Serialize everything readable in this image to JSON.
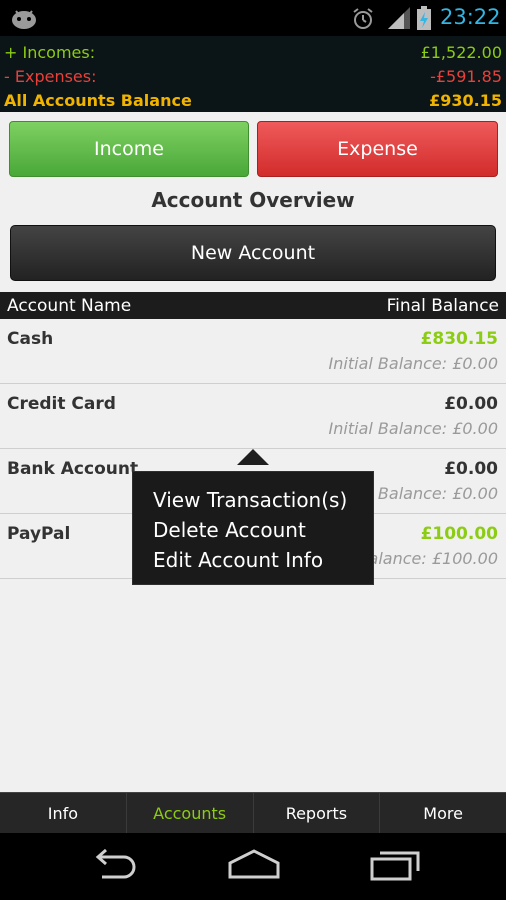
{
  "status_bar": {
    "time": "23:22",
    "icons": [
      "android-icon",
      "alarm-icon",
      "signal-icon",
      "battery-icon"
    ]
  },
  "summary": {
    "incomes_label": "+ Incomes:",
    "incomes_value": "£1,522.00",
    "expenses_label": "- Expenses:",
    "expenses_value": "-£591.85",
    "balance_label": "All Accounts Balance",
    "balance_value": "£930.15"
  },
  "buttons": {
    "income": "Income",
    "expense": "Expense",
    "new_account": "New Account"
  },
  "overview_title": "Account Overview",
  "table_header": {
    "name": "Account Name",
    "balance": "Final Balance"
  },
  "accounts": [
    {
      "name": "Cash",
      "final": "£830.15",
      "initial": "Initial Balance: £0.00",
      "color": "#8ccc14"
    },
    {
      "name": "Credit Card",
      "final": "£0.00",
      "initial": "Initial Balance: £0.00",
      "color": "#333333"
    },
    {
      "name": "Bank Account",
      "final": "£0.00",
      "initial": "Initial Balance: £0.00",
      "color": "#333333"
    },
    {
      "name": "PayPal",
      "final": "£100.00",
      "initial": "Initial Balance: £100.00",
      "color": "#8ccc14"
    }
  ],
  "context_menu": {
    "items": [
      "View Transaction(s)",
      "Delete Account",
      "Edit Account Info"
    ]
  },
  "tabs": [
    {
      "label": "Info"
    },
    {
      "label": "Accounts"
    },
    {
      "label": "Reports"
    },
    {
      "label": "More"
    }
  ],
  "colors": {
    "accent_green": "#8ccc14",
    "expense_red": "#e8403a",
    "balance_gold": "#f0b400",
    "clock_blue": "#33b5e5"
  }
}
